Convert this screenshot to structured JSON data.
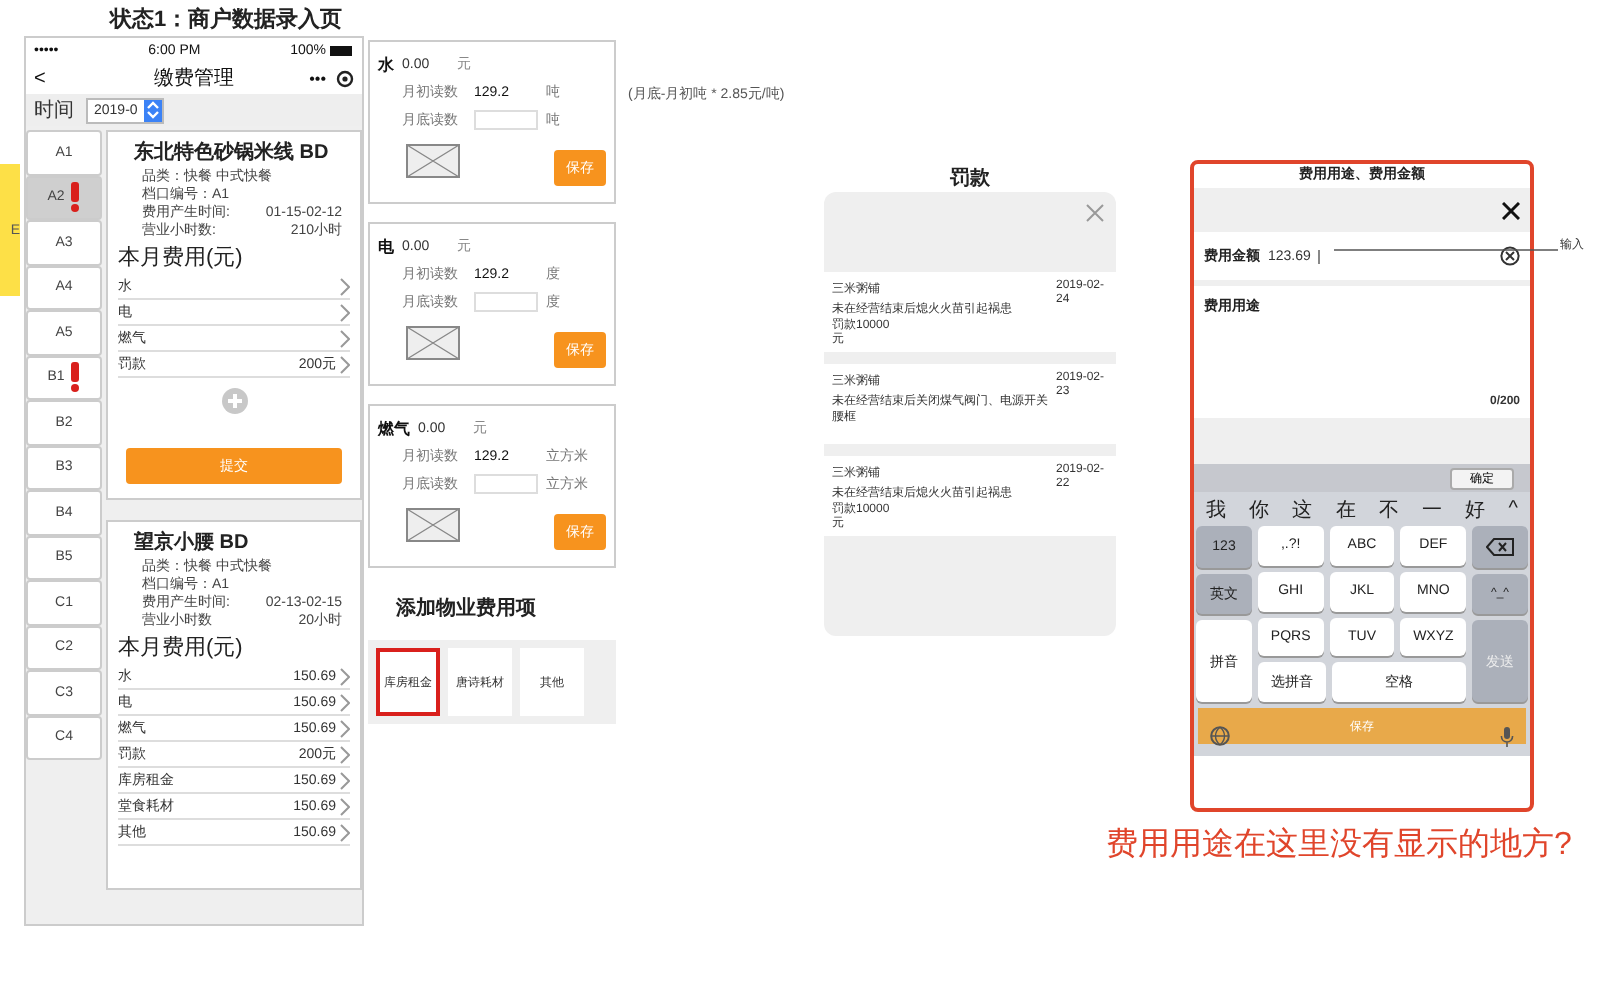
{
  "page_title": "状态1：商户数据录入页",
  "sticky_note": {
    "text": "E"
  },
  "phone": {
    "status_bar": {
      "carrier": "•••••",
      "time": "6:00 PM",
      "battery": "100%"
    },
    "nav": {
      "back": "<",
      "title": "缴费管理",
      "more": "•••"
    },
    "filter": {
      "label": "时间",
      "value": "2019-0"
    },
    "tabs": [
      {
        "label": "A1",
        "selected": false,
        "alert": false
      },
      {
        "label": "A2",
        "selected": true,
        "alert": true
      },
      {
        "label": "A3",
        "selected": false,
        "alert": false
      },
      {
        "label": "A4",
        "selected": false,
        "alert": false
      },
      {
        "label": "A5",
        "selected": false,
        "alert": false
      },
      {
        "label": "B1",
        "selected": false,
        "alert": true
      },
      {
        "label": "B2",
        "selected": false,
        "alert": false
      },
      {
        "label": "B3",
        "selected": false,
        "alert": false
      },
      {
        "label": "B4",
        "selected": false,
        "alert": false
      },
      {
        "label": "B5",
        "selected": false,
        "alert": false
      },
      {
        "label": "C1",
        "selected": false,
        "alert": false
      },
      {
        "label": "C2",
        "selected": false,
        "alert": false
      },
      {
        "label": "C3",
        "selected": false,
        "alert": false
      },
      {
        "label": "C4",
        "selected": false,
        "alert": false
      }
    ],
    "merchants": [
      {
        "name": "东北特色砂锅米线 BD",
        "category": "品类：快餐  中式快餐",
        "stall": "档口编号：A1",
        "time_label": "费用产生时间:",
        "time_value": "01-15-02-12",
        "hours_label": "营业小时数:",
        "hours_value": "210小时",
        "section": "本月费用(元)",
        "fees": [
          {
            "label": "水"
          },
          {
            "label": "电"
          },
          {
            "label": "燃气"
          },
          {
            "label": "罚款",
            "amount": "200元"
          }
        ],
        "add_icon": true,
        "submit": "提交"
      },
      {
        "name": "望京小腰 BD",
        "category": "品类：快餐  中式快餐",
        "stall": "档口编号：A1",
        "time_label": "费用产生时间:",
        "time_value": "02-13-02-15",
        "hours_label": "营业小时数",
        "hours_value": "20小时",
        "section": "本月费用(元)",
        "fees": [
          {
            "label": "水",
            "amount": "150.69"
          },
          {
            "label": "电",
            "amount": "150.69"
          },
          {
            "label": "燃气",
            "amount": "150.69"
          },
          {
            "label": "罚款",
            "amount": "200元"
          },
          {
            "label": "库房租金",
            "amount": "150.69"
          },
          {
            "label": "堂食耗材",
            "amount": "150.69"
          },
          {
            "label": "其他",
            "amount": "150.69"
          }
        ],
        "add_icon": false
      }
    ]
  },
  "meter_forms": [
    {
      "utility": "水",
      "amount": "0.00",
      "currency": "元",
      "start_label": "月初读数",
      "start_value": "129.2",
      "start_unit": "吨",
      "end_label": "月底读数",
      "end_unit": "吨",
      "save": "保存"
    },
    {
      "utility": "电",
      "amount": "0.00",
      "currency": "元",
      "start_label": "月初读数",
      "start_value": "129.2",
      "start_unit": "度",
      "end_label": "月底读数",
      "end_unit": "度",
      "save": "保存"
    },
    {
      "utility": "燃气",
      "amount": "0.00",
      "currency": "元",
      "start_label": "月初读数",
      "start_value": "129.2",
      "start_unit": "立方米",
      "end_label": "月底读数",
      "end_unit": "立方米",
      "save": "保存"
    }
  ],
  "formula_note": "(月底-月初吨 * 2.85元/吨)",
  "add_fee_items": {
    "title": "添加物业费用项",
    "options": [
      {
        "label": "库房租金",
        "selected": true
      },
      {
        "label": "唐诗耗材",
        "selected": false
      },
      {
        "label": "其他",
        "selected": false
      }
    ]
  },
  "penalty": {
    "title": "罚款",
    "records": [
      {
        "shop": "三米粥铺",
        "reason": "未在经营结束后熄火火苗引起祸患",
        "detail": "罚款10000元",
        "date": "2019-02-24"
      },
      {
        "shop": "三米粥铺",
        "reason": "未在经营结束后关闭煤气阀门、电源开关",
        "detail": "腰框",
        "date": "2019-02-23"
      },
      {
        "shop": "三米粥铺",
        "reason": "未在经营结束后熄火火苗引起祸患",
        "detail": "罚款10000元",
        "date": "2019-02-22"
      }
    ]
  },
  "modal": {
    "title": "费用用途、费用金额",
    "amount_label": "费用金额",
    "amount_value": "123.69",
    "purpose_label": "费用用途",
    "counter": "0/200",
    "confirm": "确定",
    "candidates": [
      "我",
      "你",
      "这",
      "在",
      "不",
      "一",
      "好"
    ],
    "expand": "^",
    "keyboard": {
      "left": [
        {
          "label": "123"
        },
        {
          "label": "英文"
        },
        {
          "label": "拼音"
        }
      ],
      "middle": [
        [
          ",.?!",
          "ABC",
          "DEF"
        ],
        [
          "GHI",
          "JKL",
          "MNO"
        ],
        [
          "PQRS",
          "TUV",
          "WXYZ"
        ],
        [
          "选拼音",
          "空格"
        ]
      ],
      "right": [
        {
          "kind": "delete"
        },
        {
          "kind": "emoticon",
          "label": "^_^"
        },
        {
          "kind": "send",
          "label": "发送",
          "disabled": true
        }
      ]
    },
    "save": "保存"
  },
  "callout": "输入",
  "question": "费用用途在这里没有显示的地方?"
}
